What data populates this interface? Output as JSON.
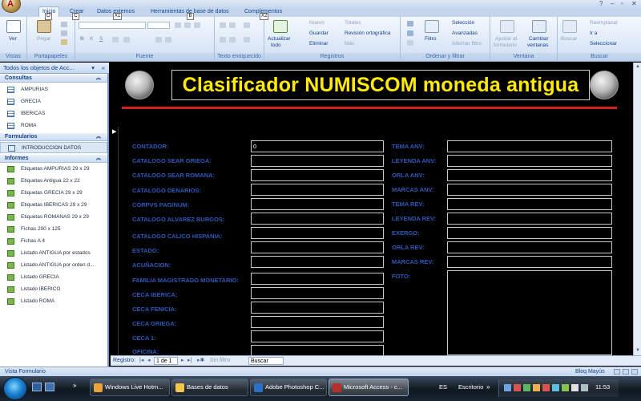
{
  "app": {
    "office_button_letter": "A",
    "window_controls": [
      "?",
      "–",
      "▫",
      "✕"
    ]
  },
  "ribbon_tabs": [
    {
      "label": "Inicio",
      "keytip": "O",
      "active": true
    },
    {
      "label": "Crear",
      "keytip": "C",
      "active": false
    },
    {
      "label": "Datos externos",
      "keytip": "X1",
      "active": false
    },
    {
      "label": "Herramientas de base de datos",
      "keytip": "B",
      "active": false
    },
    {
      "label": "Complementos",
      "keytip": "X2",
      "active": false
    }
  ],
  "ribbon": {
    "vistas": {
      "label": "Vistas",
      "ver": "Ver"
    },
    "portapapeles": {
      "label": "Portapapeles",
      "pegar": "Pegar"
    },
    "fuente": {
      "label": "Fuente",
      "bold": "N",
      "italic": "K",
      "underline": "S"
    },
    "texto": {
      "label": "Texto enriquecido"
    },
    "actualizar": {
      "line1": "Actualizar",
      "line2": "todo"
    },
    "registros": {
      "label": "Registros",
      "nuevo": "Nuevo",
      "guardar": "Guardar",
      "eliminar": "Eliminar",
      "totales": "Totales",
      "ortografia": "Revisión ortográfica",
      "mas": "Más"
    },
    "orden": {
      "label": "Ordenar y filtrar",
      "filtro": "Filtro",
      "seleccion": "Selección",
      "avanzadas": "Avanzadas",
      "alternar": "Alternar filtro"
    },
    "ventana": {
      "label": "Ventana",
      "ajustar1": "Ajustar al",
      "ajustar2": "formulario",
      "cambiar1": "Cambiar",
      "cambiar2": "ventanas"
    },
    "buscar": {
      "label": "Buscar",
      "buscar": "Buscar",
      "reemplazar": "Reemplazar",
      "ira": "Ir a",
      "seleccionar": "Seleccionar"
    }
  },
  "nav": {
    "header": "Todos los objetos de Acc...",
    "sections": [
      {
        "title": "Consultas",
        "items": [
          {
            "label": "AMPURIAS",
            "icon": "table-icon"
          },
          {
            "label": "GRECIA",
            "icon": "table-icon"
          },
          {
            "label": "IBERICAS",
            "icon": "table-icon"
          },
          {
            "label": "ROMA",
            "icon": "table-icon"
          }
        ]
      },
      {
        "title": "Formularios",
        "items": [
          {
            "label": "INTRODUCCION DATOS",
            "icon": "form-icon",
            "selected": true
          }
        ]
      },
      {
        "title": "Informes",
        "items": [
          {
            "label": "Etiquetas AMPURIAS 29 x 29",
            "icon": "report-icon"
          },
          {
            "label": "Etiquetas Antigua 22 x 22",
            "icon": "report-icon"
          },
          {
            "label": "Etiquetas GRECIA 29 x 29",
            "icon": "report-icon"
          },
          {
            "label": "Etiquetas IBERICAS 29 x 29",
            "icon": "report-icon"
          },
          {
            "label": "Etiquetas ROMANAS 29 x 29",
            "icon": "report-icon"
          },
          {
            "label": "Fichas 200 x 125",
            "icon": "report-icon"
          },
          {
            "label": "Fichas A 4",
            "icon": "report-icon"
          },
          {
            "label": "Listado ANTIGUA por estados",
            "icon": "report-icon"
          },
          {
            "label": "Listado ANTIGUA por orden d...",
            "icon": "report-icon"
          },
          {
            "label": "Listado GRECIA",
            "icon": "report-icon"
          },
          {
            "label": "Listado IBERICO",
            "icon": "report-icon"
          },
          {
            "label": "Listado ROMA",
            "icon": "report-icon"
          }
        ]
      }
    ]
  },
  "form": {
    "title": "Clasificador NUMISCOM moneda antigua",
    "left_fields": [
      {
        "label": "CONTADOR:",
        "value": "0"
      },
      {
        "label": "CATALOGO SEAR GRIEGA:",
        "value": ""
      },
      {
        "label": "CATALOGO SEAR ROMANA:",
        "value": ""
      },
      {
        "label": "CATALOGO DENARIOS:",
        "value": ""
      },
      {
        "label": "CORPVS PAG/NUM:",
        "value": ""
      },
      {
        "label": "CATALOGO ALVAREZ BURGOS:",
        "value": ""
      },
      {
        "label": "CATALOGO CALICO HISPANIA:",
        "value": ""
      },
      {
        "label": "ESTADO:",
        "value": ""
      },
      {
        "label": "ACUÑACION:",
        "value": ""
      },
      {
        "label": "FAMILIA MAGISTRADO MONETARIO:",
        "value": ""
      },
      {
        "label": "CECA IBERICA:",
        "value": ""
      },
      {
        "label": "CECA FENICIA:",
        "value": ""
      },
      {
        "label": "CECA GRIEGA:",
        "value": ""
      },
      {
        "label": "CECA 1:",
        "value": ""
      },
      {
        "label": "OFICINA:",
        "value": ""
      }
    ],
    "right_fields": [
      {
        "label": "TEMA ANV:",
        "value": ""
      },
      {
        "label": "LEYENDA ANV:",
        "value": ""
      },
      {
        "label": "ORLA ANV:",
        "value": ""
      },
      {
        "label": "MARCAS ANV:",
        "value": ""
      },
      {
        "label": "TEMA REV:",
        "value": ""
      },
      {
        "label": "LEYENDA REV:",
        "value": ""
      },
      {
        "label": "EXERGO:",
        "value": ""
      },
      {
        "label": "ORLA REV:",
        "value": ""
      },
      {
        "label": "MARCAS REV:",
        "value": ""
      },
      {
        "label": "FOTO:",
        "value": ""
      }
    ]
  },
  "record_nav": {
    "label": "Registro:",
    "position": "1 de 1",
    "filter": "Sin filtro",
    "search": "Buscar"
  },
  "status": {
    "left": "Vista Formulario",
    "right": "Bloq Mayús"
  },
  "taskbar": {
    "buttons": [
      {
        "label": "Windows Live Hotm...",
        "color": "#e8a33a",
        "active": false
      },
      {
        "label": "Bases de datos",
        "color": "#f2c84b",
        "active": false
      },
      {
        "label": "Adobe Photoshop C...",
        "color": "#2a6fc9",
        "active": false
      },
      {
        "label": "Microsoft Access - c...",
        "color": "#b5302a",
        "active": true
      }
    ],
    "lang": "ES",
    "desktop": "Escritorio",
    "clock": "11:53"
  }
}
